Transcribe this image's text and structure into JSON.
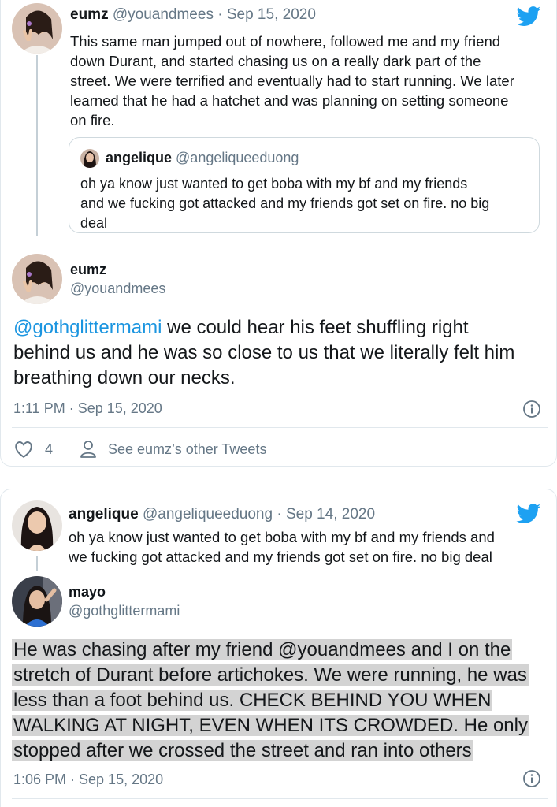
{
  "tweet1": {
    "name": "eumz",
    "handle": "@youandmees",
    "date": "Sep 15, 2020",
    "separator": "·",
    "text_lines": [
      "This same man jumped out of nowhere, followed me and my friend",
      "down Durant, and started chasing us on a really dark part of the",
      "street. We were terrified and eventually had to start running. We later",
      "learned that he had a hatchet and was planning on setting someone",
      "on fire."
    ],
    "quote": {
      "name": "angelique",
      "handle": "@angeliqueeduong",
      "text_lines": [
        "oh ya know just wanted to get boba with my bf and my friends",
        "and we fucking got attacked and my friends got set on fire. no big",
        "deal"
      ]
    }
  },
  "tweet2": {
    "name": "eumz",
    "handle": "@youandmees",
    "mention": "@gothglittermami",
    "text_line1_rest": " we could hear his feet shuffling right",
    "text_lines": [
      "behind us and he was so close to us that we literally felt him",
      "breathing down our necks."
    ],
    "timestamp": "1:11 PM · Sep 15, 2020",
    "likes": "4",
    "other_tweets_label": "See eumz’s other Tweets"
  },
  "tweet3": {
    "name": "angelique",
    "handle": "@angeliqueeduong",
    "date": "Sep 14, 2020",
    "separator": "·",
    "text_lines": [
      "oh ya know just wanted to get boba with my bf and my friends and",
      "we fucking got attacked and my friends got set on fire. no big deal"
    ]
  },
  "tweet4": {
    "name": "mayo",
    "handle": "@gothglittermami",
    "text_lines": [
      "He was chasing after my friend @youandmees and I on the",
      "stretch of Durant before artichokes. We were running, he was",
      "less than a foot behind us. CHECK BEHIND YOU WHEN",
      "WALKING AT NIGHT, EVEN WHEN ITS CROWDED. He only",
      "stopped after we crossed the street and ran into others"
    ],
    "timestamp": "1:06 PM · Sep 15, 2020"
  },
  "colors": {
    "twitter_blue": "#1da1f2",
    "mention_blue": "#1b95e0",
    "secondary_text": "#657786",
    "highlight": "#d3d3d3"
  },
  "icons": [
    "twitter-logo-icon",
    "info-icon",
    "heart-icon",
    "person-icon"
  ]
}
